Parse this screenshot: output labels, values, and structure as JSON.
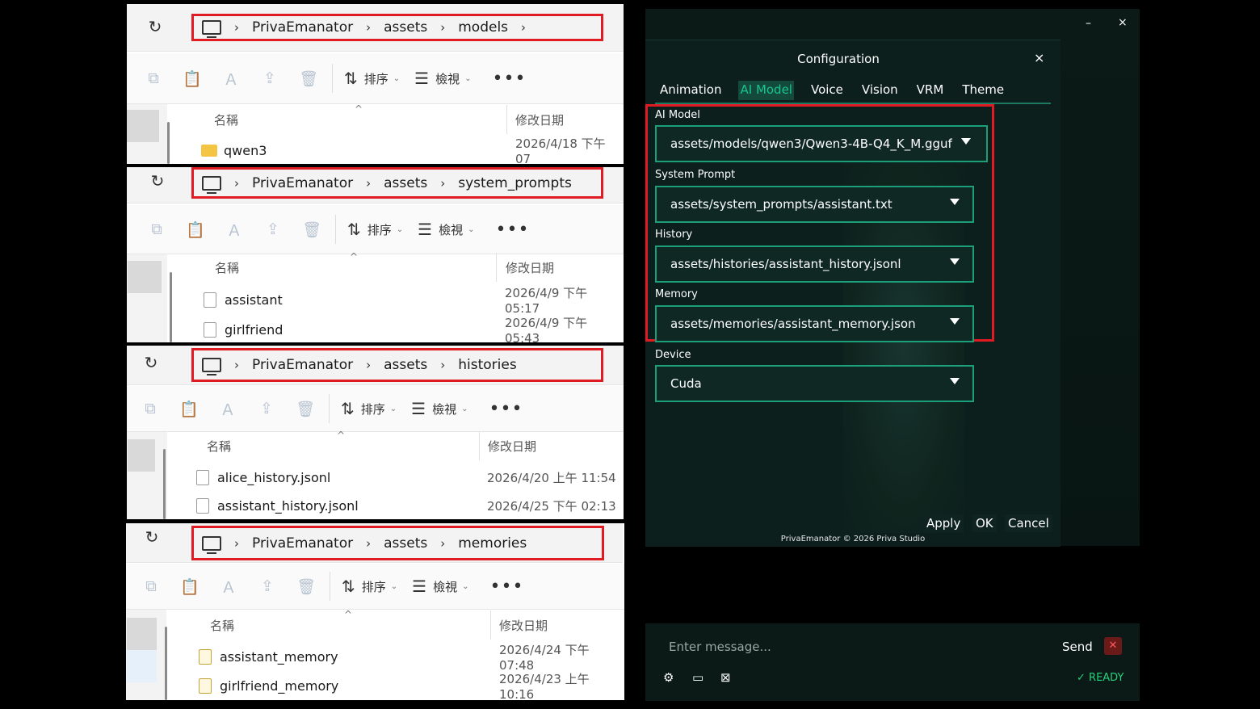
{
  "explorer_panels": [
    {
      "path": [
        "PrivaEmanator",
        "assets",
        "models"
      ],
      "header": {
        "name": "名稱",
        "date": "修改日期"
      },
      "toolbar": {
        "sort": "排序",
        "view": "檢視",
        "more": "•••"
      },
      "rows": [
        {
          "name": "qwen3",
          "date": "2026/4/18 下午 07",
          "type": "folder"
        }
      ]
    },
    {
      "path": [
        "PrivaEmanator",
        "assets",
        "system_prompts"
      ],
      "header": {
        "name": "名稱",
        "date": "修改日期"
      },
      "toolbar": {
        "sort": "排序",
        "view": "檢視",
        "more": "•••"
      },
      "rows": [
        {
          "name": "assistant",
          "date": "2026/4/9 下午 05:17",
          "type": "file"
        },
        {
          "name": "girlfriend",
          "date": "2026/4/9 下午 05:43",
          "type": "file"
        }
      ]
    },
    {
      "path": [
        "PrivaEmanator",
        "assets",
        "histories"
      ],
      "header": {
        "name": "名稱",
        "date": "修改日期"
      },
      "toolbar": {
        "sort": "排序",
        "view": "檢視",
        "more": "•••"
      },
      "rows": [
        {
          "name": "alice_history.jsonl",
          "date": "2026/4/20 上午 11:54",
          "type": "file"
        },
        {
          "name": "assistant_history.jsonl",
          "date": "2026/4/25 下午 02:13",
          "type": "file"
        }
      ]
    },
    {
      "path": [
        "PrivaEmanator",
        "assets",
        "memories"
      ],
      "header": {
        "name": "名稱",
        "date": "修改日期"
      },
      "toolbar": {
        "sort": "排序",
        "view": "檢視",
        "more": "•••"
      },
      "rows": [
        {
          "name": "assistant_memory",
          "date": "2026/4/24 下午 07:48",
          "type": "json"
        },
        {
          "name": "girlfriend_memory",
          "date": "2026/4/23 上午 10:16",
          "type": "json"
        }
      ]
    }
  ],
  "config": {
    "title": "Configuration",
    "close": "×",
    "window_min": "–",
    "window_close": "×",
    "tabs": [
      "Animation",
      "AI Model",
      "Voice",
      "Vision",
      "VRM",
      "Theme"
    ],
    "active_tab": "AI Model",
    "fields": [
      {
        "label": "AI Model",
        "value": "assets/models/qwen3/Qwen3-4B-Q4_K_M.gguf"
      },
      {
        "label": "System Prompt",
        "value": "assets/system_prompts/assistant.txt"
      },
      {
        "label": "History",
        "value": "assets/histories/assistant_history.jsonl"
      },
      {
        "label": "Memory",
        "value": "assets/memories/assistant_memory.json"
      },
      {
        "label": "Device",
        "value": "Cuda"
      }
    ],
    "buttons": {
      "apply": "Apply",
      "ok": "OK",
      "cancel": "Cancel"
    },
    "footer": "PrivaEmanator © 2026 Priva Studio"
  },
  "chat": {
    "placeholder": "Enter message...",
    "send": "Send",
    "status": "READY",
    "icons": [
      "gear-icon",
      "window-icon",
      "no-image-icon",
      "mic-muted-icon"
    ]
  },
  "colors": {
    "highlight": "#e01b24",
    "accent": "#19c48d",
    "ready": "#22d27d"
  }
}
